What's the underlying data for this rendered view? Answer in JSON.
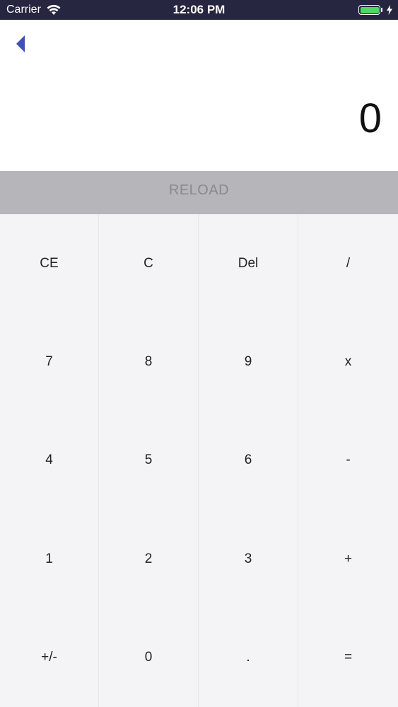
{
  "status_bar": {
    "carrier": "Carrier",
    "time": "12:06 PM",
    "battery_color": "#4cd964"
  },
  "nav": {
    "back_icon": "chevron-left-icon",
    "accent_color": "#3f51b5"
  },
  "display": {
    "value": "0"
  },
  "reload": {
    "label": "RELOAD"
  },
  "keypad": {
    "keys": [
      "CE",
      "C",
      "Del",
      "/",
      "7",
      "8",
      "9",
      "x",
      "4",
      "5",
      "6",
      "-",
      "1",
      "2",
      "3",
      "+",
      "+/-",
      "0",
      ".",
      "="
    ]
  }
}
